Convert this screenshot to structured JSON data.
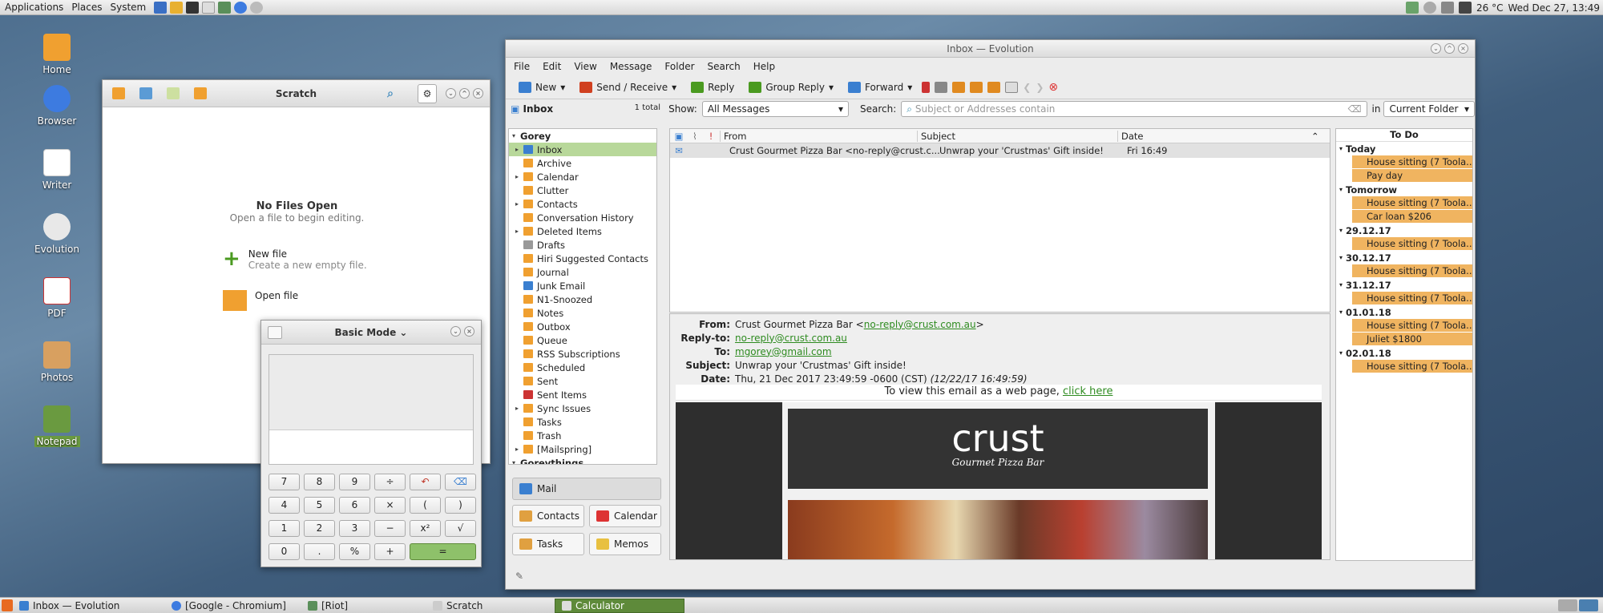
{
  "top_panel": {
    "menus": [
      "Applications",
      "Places",
      "System"
    ],
    "temperature": "26 °C",
    "clock": "Wed Dec 27, 13:49"
  },
  "desktop_icons": [
    "Home",
    "Browser",
    "Writer",
    "Evolution",
    "PDF",
    "Photos",
    "Notepad"
  ],
  "scratch": {
    "title": "Scratch",
    "empty_title": "No Files Open",
    "empty_sub": "Open a file to begin editing.",
    "new_file": "New file",
    "new_file_sub": "Create a new empty file.",
    "open_file": "Open file"
  },
  "calculator": {
    "mode": "Basic Mode",
    "buttons": [
      "7",
      "8",
      "9",
      "÷",
      "↶",
      "⌫",
      "4",
      "5",
      "6",
      "×",
      "(",
      ")",
      "1",
      "2",
      "3",
      "−",
      "x²",
      "√",
      "0",
      ".",
      "%",
      "+",
      "="
    ]
  },
  "evolution": {
    "title": "Inbox — Evolution",
    "menu": [
      "File",
      "Edit",
      "View",
      "Message",
      "Folder",
      "Search",
      "Help"
    ],
    "toolbar": {
      "new": "New",
      "send_receive": "Send / Receive",
      "reply": "Reply",
      "group_reply": "Group Reply",
      "forward": "Forward"
    },
    "sidebar_header": "Inbox",
    "total": "1 total",
    "show_label": "Show:",
    "show_value": "All Messages",
    "search_label": "Search:",
    "search_placeholder": "Subject or Addresses contain",
    "in_label": "in",
    "in_value": "Current Folder",
    "accounts": [
      {
        "name": "Gorey"
      },
      {
        "name": "Goreythings"
      }
    ],
    "folders": [
      "Inbox",
      "Archive",
      "Calendar",
      "Clutter",
      "Contacts",
      "Conversation History",
      "Deleted Items",
      "Drafts",
      "Hiri Suggested Contacts",
      "Journal",
      "Junk Email",
      "N1-Snoozed",
      "Notes",
      "Outbox",
      "Queue",
      "RSS Subscriptions",
      "Scheduled",
      "Sent",
      "Sent Items",
      "Sync Issues",
      "Tasks",
      "Trash",
      "[Mailspring]"
    ],
    "sub_inbox": "Inbox",
    "switcher": {
      "mail": "Mail",
      "contacts": "Contacts",
      "calendar": "Calendar",
      "tasks": "Tasks",
      "memos": "Memos"
    },
    "columns": {
      "from": "From",
      "subject": "Subject",
      "date": "Date"
    },
    "message": {
      "from": "Crust Gourmet Pizza Bar <no-reply@crust.c...",
      "subject": "Unwrap your 'Crustmas' Gift inside!",
      "date": "Fri 16:49"
    },
    "preview": {
      "from_label": "From:",
      "from_name": "Crust Gourmet Pizza Bar <",
      "from_email": "no-reply@crust.com.au",
      "from_end": ">",
      "replyto_label": "Reply-to:",
      "replyto": "no-reply@crust.com.au",
      "to_label": "To:",
      "to": "mgorey@gmail.com",
      "subject_label": "Subject:",
      "subject": "Unwrap your 'Crustmas' Gift inside!",
      "date_label": "Date:",
      "date": "Thu, 21 Dec 2017 23:49:59 -0600 (CST)",
      "date_local": "(12/22/17 16:49:59)",
      "webview": "To view this email as a web page,",
      "click_here": "click here",
      "brand": "crust",
      "brand_sub": "Gourmet Pizza Bar"
    },
    "todo": {
      "title": "To Do",
      "groups": [
        {
          "day": "Today",
          "items": [
            "House sitting (7 Toola...",
            "Pay day"
          ]
        },
        {
          "day": "Tomorrow",
          "items": [
            "House sitting (7 Toola...",
            "Car loan $206"
          ]
        },
        {
          "day": "29.12.17",
          "items": [
            "House sitting (7 Toola..."
          ]
        },
        {
          "day": "30.12.17",
          "items": [
            "House sitting (7 Toola..."
          ]
        },
        {
          "day": "31.12.17",
          "items": [
            "House sitting (7 Toola..."
          ]
        },
        {
          "day": "01.01.18",
          "items": [
            "House sitting (7 Toola...",
            "Juliet $1800"
          ]
        },
        {
          "day": "02.01.18",
          "items": [
            "House sitting (7 Toola..."
          ]
        }
      ]
    }
  },
  "taskbar": [
    "Inbox — Evolution",
    "[Google - Chromium]",
    "[Riot]",
    "Scratch",
    "Calculator"
  ]
}
